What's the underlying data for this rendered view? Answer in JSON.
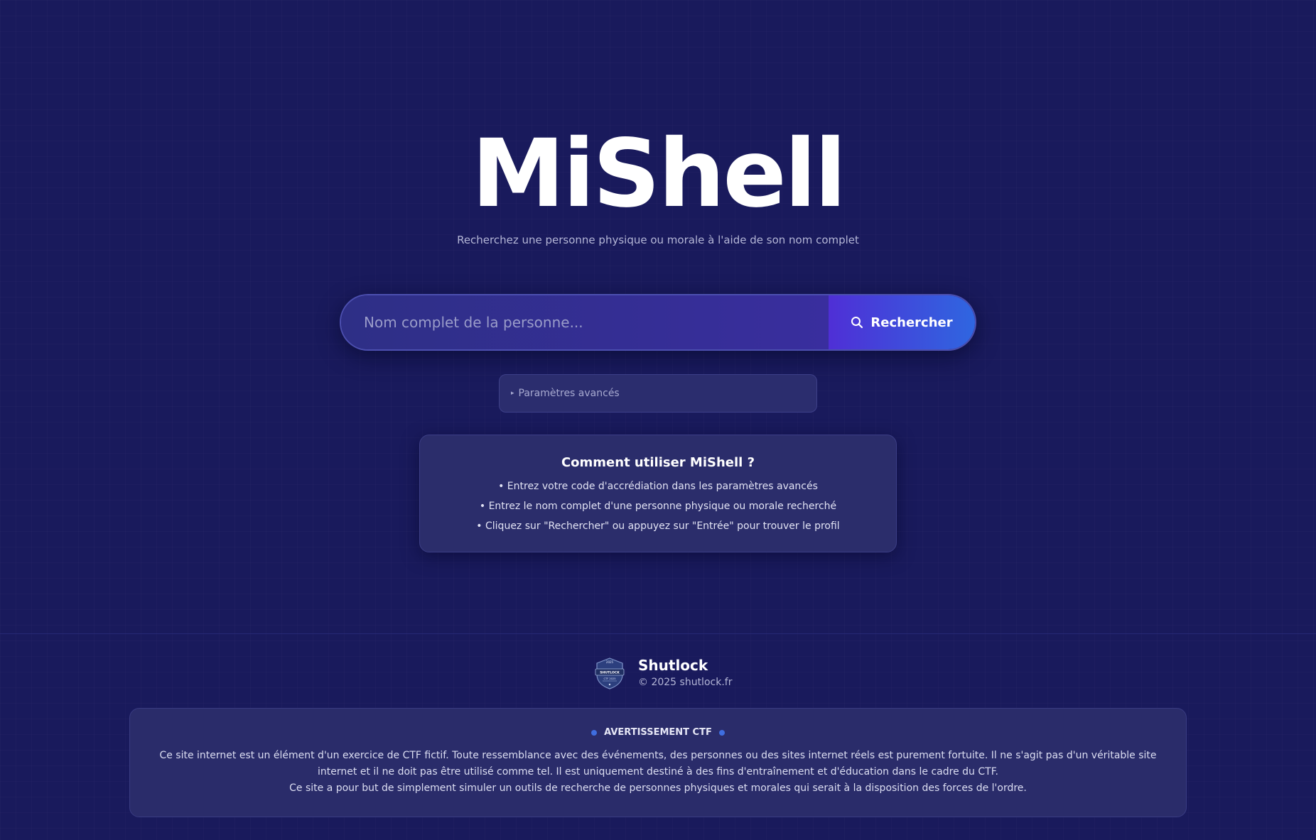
{
  "app": {
    "title": "MiShell",
    "subtitle": "Recherchez une personne physique ou morale à l'aide de son nom complet"
  },
  "search": {
    "placeholder": "Nom complet de la personne...",
    "value": "",
    "button_label": "Rechercher",
    "button_icon": "search-icon"
  },
  "advanced": {
    "label": "Paramètres avancés",
    "arrow": "▸"
  },
  "howto": {
    "title": "Comment utiliser MiShell ?",
    "items": [
      "• Entrez votre code d'accrédiation dans les paramètres avancés",
      "• Entrez le nom complet d'une personne physique ou morale recherché",
      "• Cliquez sur \"Rechercher\" ou appuyez sur \"Entrée\" pour trouver le profil"
    ]
  },
  "footer": {
    "brand_name": "Shutlock",
    "copyright": "© 2025 shutlock.fr",
    "logo": "shutlock-ctf-2025-badge",
    "logo_texts": [
      "2025",
      "SHUTLOCK",
      "CTF 2025"
    ],
    "warning": {
      "title": "AVERTISSEMENT CTF",
      "line1": "Ce site internet est un élément d'un exercice de CTF fictif. Toute ressemblance avec des événements, des personnes ou des sites internet réels est purement fortuite. Il ne s'agit pas d'un véritable site internet et il ne doit pas être utilisé comme tel. Il est uniquement destiné à des fins d'entraînement et d'éducation dans le cadre du CTF.",
      "line2": "Ce site a pour but de simplement simuler un outils de recherche de personnes physiques et morales qui serait à la disposition des forces de l'ordre."
    }
  },
  "colors": {
    "background": "#191a5c",
    "accent_start": "#4f2fd6",
    "accent_end": "#2f66e0",
    "dot": "#3f6ee0"
  }
}
